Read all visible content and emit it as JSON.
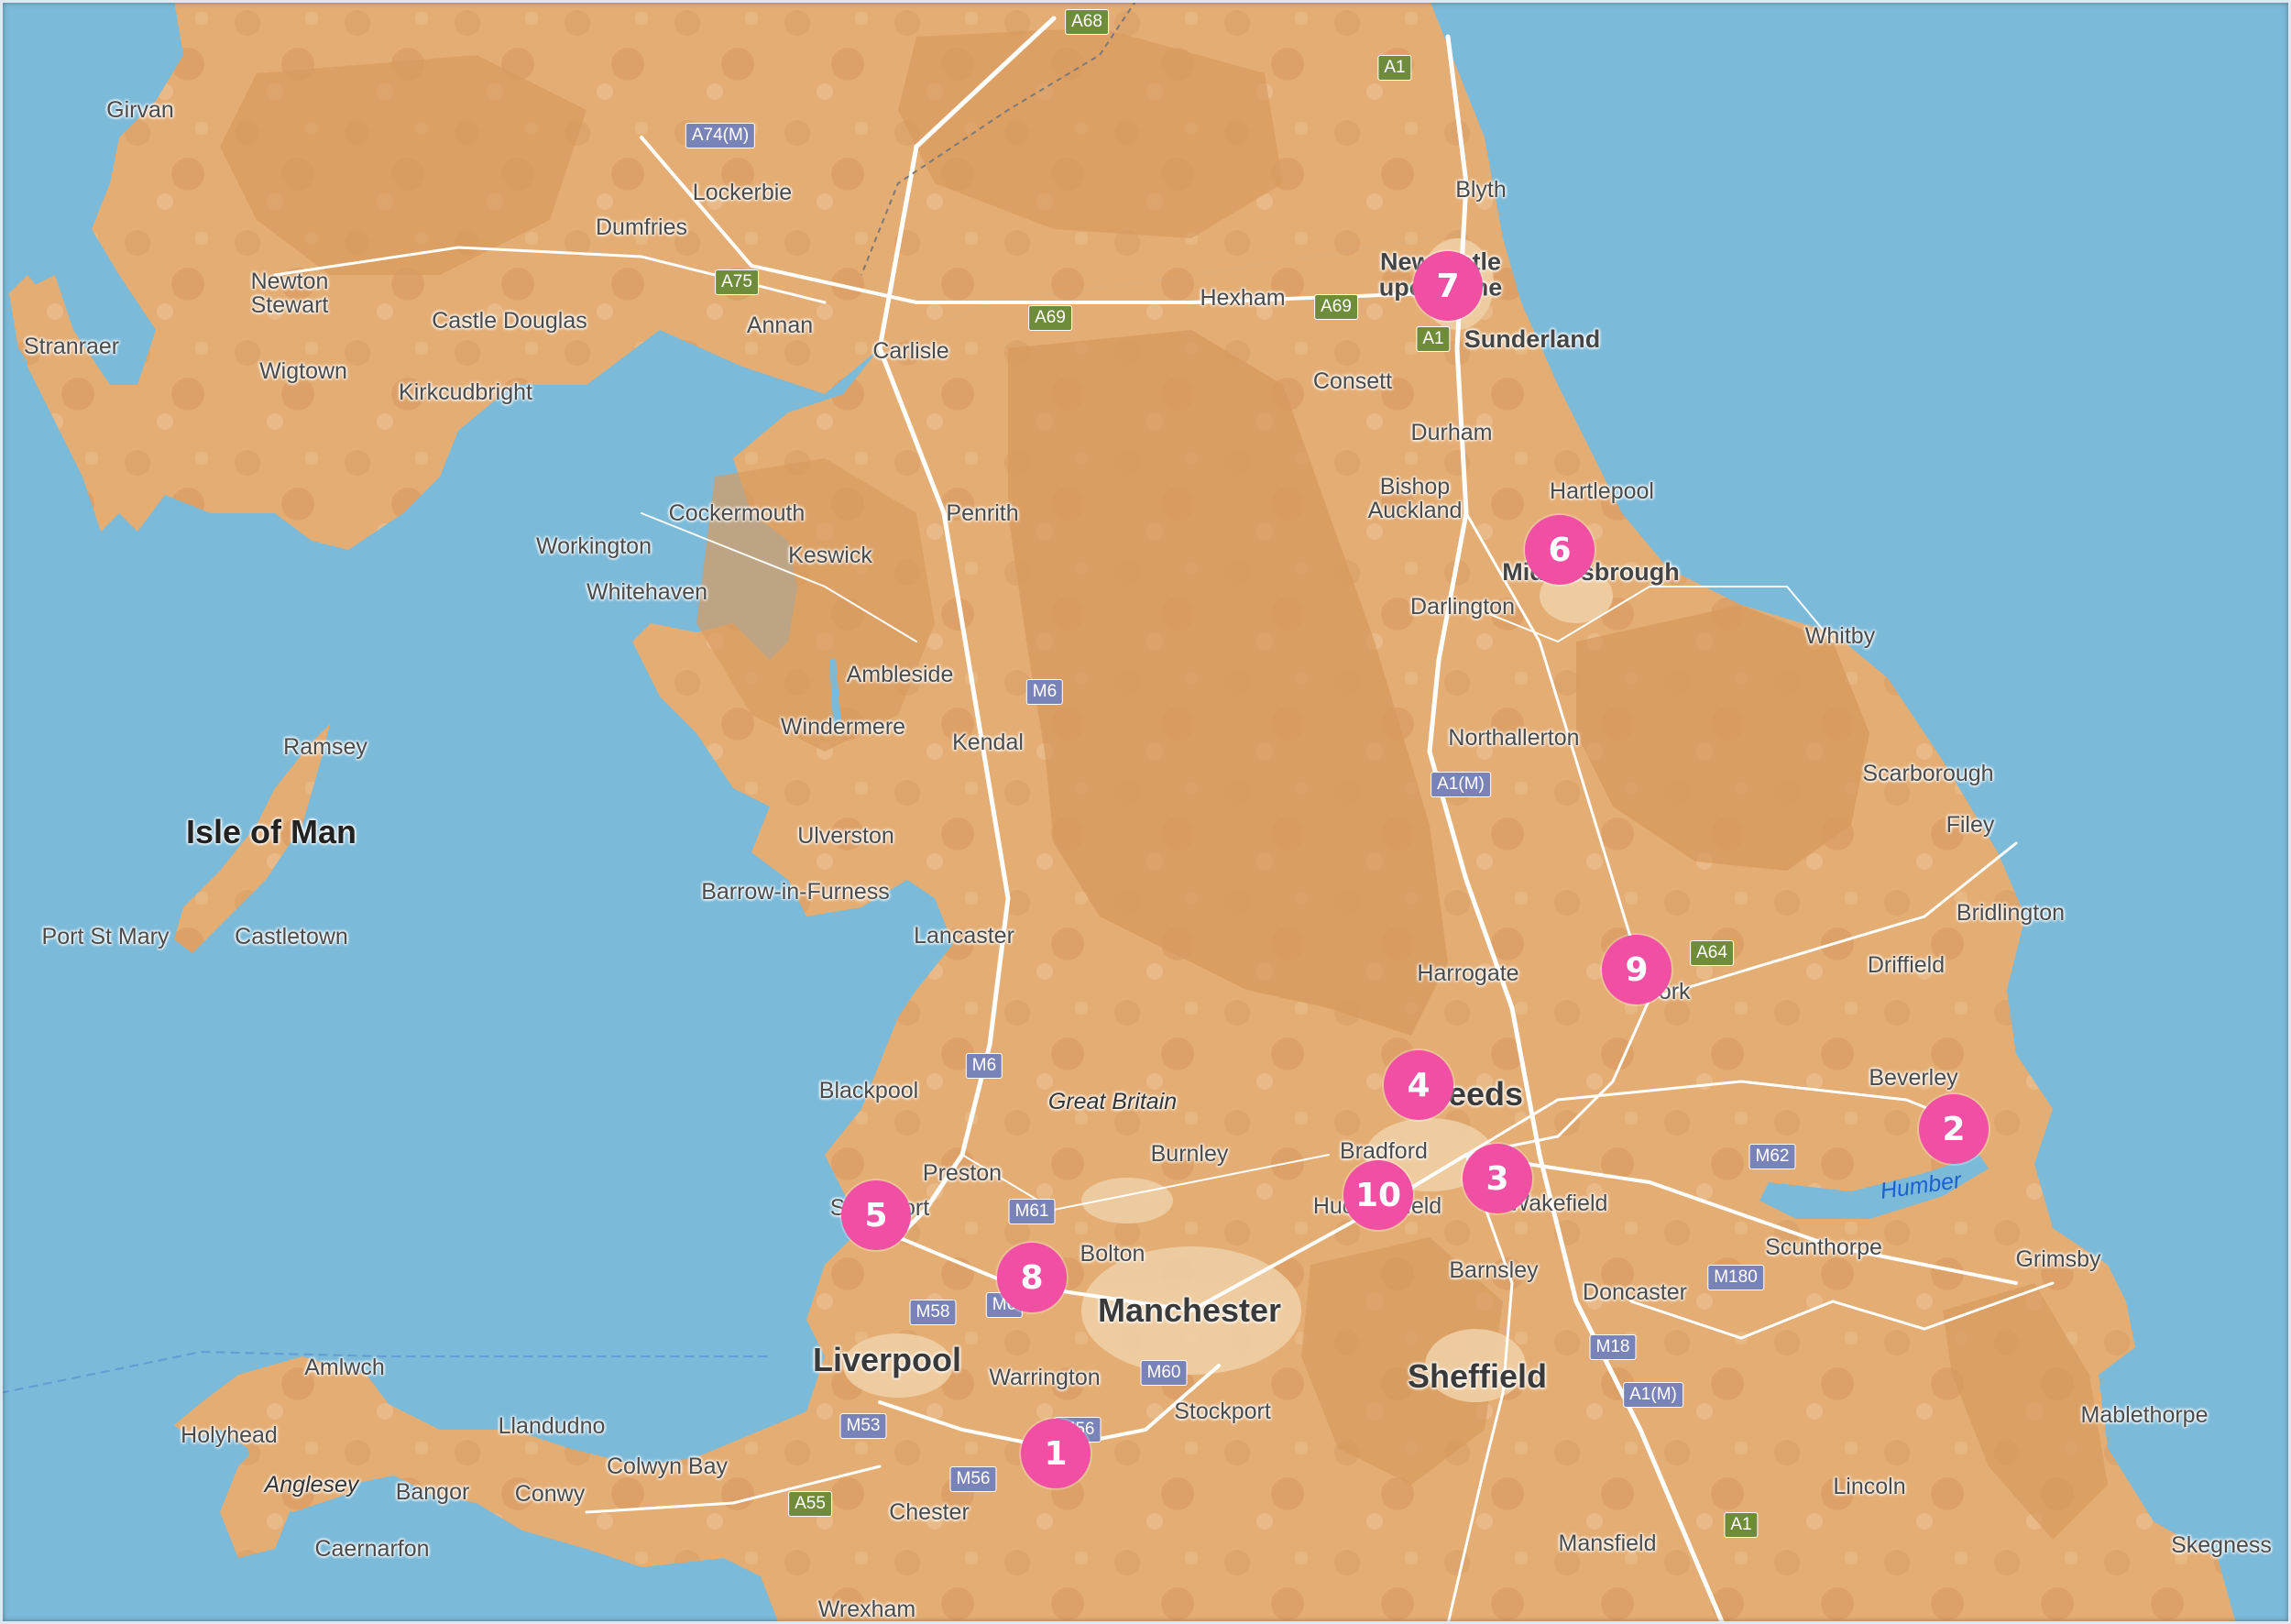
{
  "colors": {
    "sea": "#7bbad9",
    "land": "#e4ad73",
    "land_dark": "#d79a5e",
    "land_light": "#efcfa5",
    "road": "#ffffff",
    "marker": "#f04fa3",
    "motorway_shield": "#7a83b8",
    "a_road_shield": "#6e8c3a"
  },
  "regions": [
    {
      "name": "Isle of Man"
    },
    {
      "name": "Great Britain"
    }
  ],
  "places": [
    {
      "name": "Girvan"
    },
    {
      "name": "Lockerbie"
    },
    {
      "name": "Dumfries"
    },
    {
      "name": "Newton\nStewart"
    },
    {
      "name": "Castle Douglas"
    },
    {
      "name": "Annan"
    },
    {
      "name": "Stranraer"
    },
    {
      "name": "Wigtown"
    },
    {
      "name": "Kirkcudbright"
    },
    {
      "name": "Carlisle"
    },
    {
      "name": "Hexham"
    },
    {
      "name": "Blyth"
    },
    {
      "name": "Newcastle\nupon Tyne"
    },
    {
      "name": "Sunderland"
    },
    {
      "name": "Consett"
    },
    {
      "name": "Durham"
    },
    {
      "name": "Bishop\nAuckland"
    },
    {
      "name": "Hartlepool"
    },
    {
      "name": "Middlesbrough"
    },
    {
      "name": "Darlington"
    },
    {
      "name": "Whitby"
    },
    {
      "name": "Cockermouth"
    },
    {
      "name": "Penrith"
    },
    {
      "name": "Workington"
    },
    {
      "name": "Keswick"
    },
    {
      "name": "Whitehaven"
    },
    {
      "name": "Ambleside"
    },
    {
      "name": "Windermere"
    },
    {
      "name": "Kendal"
    },
    {
      "name": "Northallerton"
    },
    {
      "name": "Scarborough"
    },
    {
      "name": "Filey"
    },
    {
      "name": "Ramsey"
    },
    {
      "name": "Ulverston"
    },
    {
      "name": "Barrow-in-Furness"
    },
    {
      "name": "Port St Mary"
    },
    {
      "name": "Castletown"
    },
    {
      "name": "Lancaster"
    },
    {
      "name": "Bridlington"
    },
    {
      "name": "Harrogate"
    },
    {
      "name": "York"
    },
    {
      "name": "Driffield"
    },
    {
      "name": "Blackpool"
    },
    {
      "name": "Leeds"
    },
    {
      "name": "Beverley"
    },
    {
      "name": "Bradford"
    },
    {
      "name": "Burnley"
    },
    {
      "name": "Preston"
    },
    {
      "name": "Wakefield"
    },
    {
      "name": "Southport"
    },
    {
      "name": "Huddersfield"
    },
    {
      "name": "Bolton"
    },
    {
      "name": "Scunthorpe"
    },
    {
      "name": "Grimsby"
    },
    {
      "name": "Barnsley"
    },
    {
      "name": "Doncaster"
    },
    {
      "name": "Manchester"
    },
    {
      "name": "Liverpool"
    },
    {
      "name": "Warrington"
    },
    {
      "name": "Sheffield"
    },
    {
      "name": "Amlwch"
    },
    {
      "name": "Stockport"
    },
    {
      "name": "Mablethorpe"
    },
    {
      "name": "Holyhead"
    },
    {
      "name": "Llandudno"
    },
    {
      "name": "Colwyn Bay"
    },
    {
      "name": "Anglesey"
    },
    {
      "name": "Bangor"
    },
    {
      "name": "Conwy"
    },
    {
      "name": "Chester"
    },
    {
      "name": "Lincoln"
    },
    {
      "name": "Caernarfon"
    },
    {
      "name": "Mansfield"
    },
    {
      "name": "Skegness"
    },
    {
      "name": "Wrexham"
    },
    {
      "name": "Humber"
    }
  ],
  "road_shields": [
    {
      "label": "A68",
      "type": "A"
    },
    {
      "label": "A1",
      "type": "A"
    },
    {
      "label": "A74(M)",
      "type": "M"
    },
    {
      "label": "A75",
      "type": "A"
    },
    {
      "label": "A69",
      "type": "A"
    },
    {
      "label": "A69",
      "type": "A"
    },
    {
      "label": "A1",
      "type": "A"
    },
    {
      "label": "M6",
      "type": "M"
    },
    {
      "label": "A1(M)",
      "type": "M"
    },
    {
      "label": "A64",
      "type": "A"
    },
    {
      "label": "M6",
      "type": "M"
    },
    {
      "label": "M62",
      "type": "M"
    },
    {
      "label": "M61",
      "type": "M"
    },
    {
      "label": "M6",
      "type": "M"
    },
    {
      "label": "M58",
      "type": "M"
    },
    {
      "label": "M180",
      "type": "M"
    },
    {
      "label": "M18",
      "type": "M"
    },
    {
      "label": "M60",
      "type": "M"
    },
    {
      "label": "A1(M)",
      "type": "M"
    },
    {
      "label": "M53",
      "type": "M"
    },
    {
      "label": "M56",
      "type": "M"
    },
    {
      "label": "M56",
      "type": "M"
    },
    {
      "label": "A55",
      "type": "A"
    },
    {
      "label": "A1",
      "type": "A"
    }
  ],
  "markers": [
    {
      "label": "1"
    },
    {
      "label": "2"
    },
    {
      "label": "3"
    },
    {
      "label": "4"
    },
    {
      "label": "5"
    },
    {
      "label": "6"
    },
    {
      "label": "7"
    },
    {
      "label": "8"
    },
    {
      "label": "9"
    },
    {
      "label": "10"
    }
  ]
}
